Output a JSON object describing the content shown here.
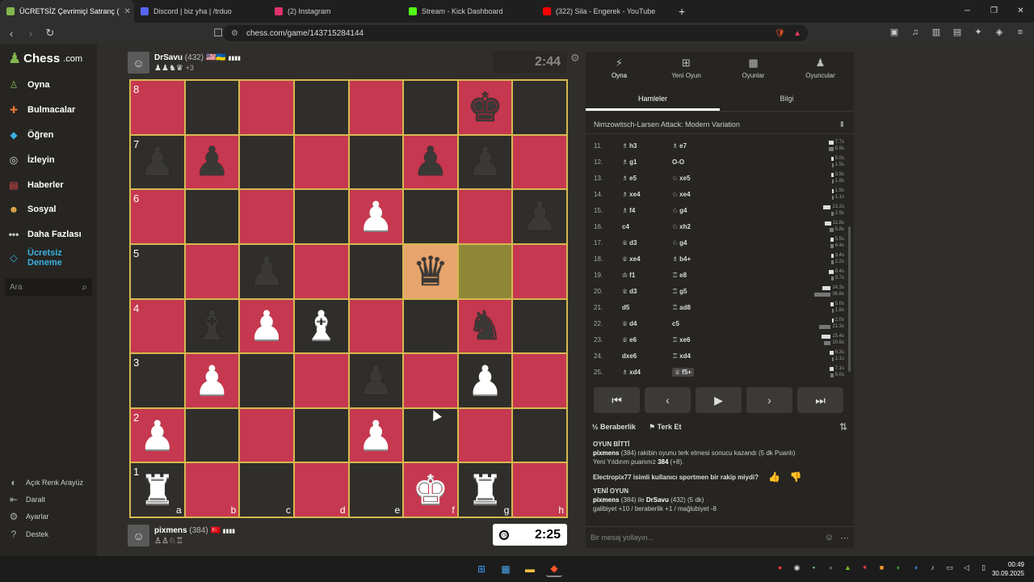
{
  "browser": {
    "tabs": [
      {
        "label": "ÜCRETSİZ Çevrimiçi Satranç (",
        "active": true,
        "color": "#81b64c"
      },
      {
        "label": "Discord | biz yha | /trduo",
        "active": false,
        "color": "#5865f2"
      },
      {
        "label": "(2) Instagram",
        "active": false,
        "color": "#e1306c"
      },
      {
        "label": "Stream - Kick Dashboard",
        "active": false,
        "color": "#53fc18"
      },
      {
        "label": "(322) Sila - Engerek - YouTube",
        "active": false,
        "color": "#ff0000"
      }
    ],
    "new_tab": "+",
    "url": "chess.com/game/143715284144"
  },
  "sidebar": {
    "logo": "Chess",
    "logo_suffix": ".com",
    "items": [
      {
        "label": "Oyna",
        "icon": "play-board-icon",
        "color": "#81b64c"
      },
      {
        "label": "Bulmacalar",
        "icon": "puzzle-icon",
        "color": "#e8772e"
      },
      {
        "label": "Öğren",
        "icon": "learn-icon",
        "color": "#3bb0e0"
      },
      {
        "label": "İzleyin",
        "icon": "binoculars-icon",
        "color": "#dddddd"
      },
      {
        "label": "Haberler",
        "icon": "news-icon",
        "color": "#e84a4a"
      },
      {
        "label": "Sosyal",
        "icon": "social-icon",
        "color": "#e8b04a"
      },
      {
        "label": "Daha Fazlası",
        "icon": "more-icon",
        "color": "#cccccc"
      },
      {
        "label": "Ücretsiz Deneme",
        "icon": "diamond-icon",
        "color": "#3bb0e0"
      }
    ],
    "search_placeholder": "Ara",
    "footer": [
      {
        "label": "Açık Renk Arayüz",
        "icon": "theme-toggle-icon"
      },
      {
        "label": "Daralt",
        "icon": "collapse-icon"
      },
      {
        "label": "Ayarlar",
        "icon": "settings-icon"
      },
      {
        "label": "Destek",
        "icon": "help-icon"
      }
    ]
  },
  "top_player": {
    "name": "DrSavu",
    "rating": "(432)",
    "flags": "🇺🇸🇺🇦",
    "signal": "▮▮▮▮",
    "captured": "♟♟♞♛",
    "extra": "+3"
  },
  "bottom_player": {
    "name": "pixmens",
    "rating": "(384)",
    "flags": "🇹🇷",
    "signal": "▮▮▮▮",
    "captured": "♙♙♘♖"
  },
  "clocks": {
    "top": "2:44",
    "bottom": "2:25"
  },
  "board": {
    "ranks": [
      "8",
      "7",
      "6",
      "5",
      "4",
      "3",
      "2",
      "1"
    ],
    "files": [
      "a",
      "b",
      "c",
      "d",
      "e",
      "f",
      "g",
      "h"
    ],
    "squares": [
      [
        "",
        "",
        "",
        "",
        "",
        "",
        "bk",
        ""
      ],
      [
        "bp",
        "bp",
        "",
        "",
        "",
        "bp",
        "bp",
        ""
      ],
      [
        "",
        "",
        "",
        "",
        "wp",
        "",
        "",
        "bp"
      ],
      [
        "",
        "",
        "bp",
        "",
        "",
        "bq",
        "",
        ""
      ],
      [
        "",
        "bb",
        "wp",
        "wb",
        "",
        "",
        "bn",
        ""
      ],
      [
        "",
        "wp",
        "",
        "",
        "bp",
        "",
        "wp",
        ""
      ],
      [
        "wp",
        "",
        "",
        "",
        "wp",
        "",
        "",
        ""
      ],
      [
        "wr",
        "",
        "",
        "",
        "",
        "wk",
        "wr",
        ""
      ]
    ],
    "highlight_from": "g5",
    "highlight_to": "f5"
  },
  "panel": {
    "tabs": [
      {
        "label": "Oyna",
        "icon": "bolt-icon"
      },
      {
        "label": "Yeni Oyun",
        "icon": "plus-icon"
      },
      {
        "label": "Oyunlar",
        "icon": "board-icon"
      },
      {
        "label": "Oyuncular",
        "icon": "players-icon"
      }
    ],
    "subtabs": [
      "Hamleler",
      "Bilgi"
    ],
    "opening": "Nimzowitsch-Larsen Attack: Modern Variation",
    "moves": [
      {
        "n": "11.",
        "w": "h3",
        "wp": "♗",
        "b": "e7",
        "bp": "♗",
        "wt": "7.7s",
        "bt": "8.9s",
        "ww": 6,
        "bw": 6
      },
      {
        "n": "12.",
        "w": "g1",
        "wp": "♗",
        "b": "O-O",
        "bp": "",
        "wt": "5.0s",
        "bt": "1.5s",
        "ww": 3,
        "bw": 2
      },
      {
        "n": "13.",
        "w": "e5",
        "wp": "♗",
        "b": "xe5",
        "bp": "♘",
        "wt": "3.9s",
        "bt": "1.8s",
        "ww": 3,
        "bw": 2
      },
      {
        "n": "14.",
        "w": "xe4",
        "wp": "♗",
        "b": "xe4",
        "bp": "♘",
        "wt": "1.9s",
        "bt": "1.1s",
        "ww": 2,
        "bw": 2
      },
      {
        "n": "15.",
        "w": "f4",
        "wp": "♗",
        "b": "g4",
        "bp": "♘",
        "wt": "13.2s",
        "bt": "2.9s",
        "ww": 9,
        "bw": 3
      },
      {
        "n": "16.",
        "w": "c4",
        "wp": "",
        "b": "xh2",
        "bp": "♘",
        "wt": "11.8s",
        "bt": "5.8s",
        "ww": 8,
        "bw": 5
      },
      {
        "n": "17.",
        "w": "d3",
        "wp": "♕",
        "b": "g4",
        "bp": "♘",
        "wt": "5.5s",
        "bt": "4.4s",
        "ww": 4,
        "bw": 4
      },
      {
        "n": "18.",
        "w": "xe4",
        "wp": "♕",
        "b": "b4+",
        "bp": "♗",
        "wt": "3.4s",
        "bt": "2.2s",
        "ww": 3,
        "bw": 3
      },
      {
        "n": "19.",
        "w": "f1",
        "wp": "♔",
        "b": "e8",
        "bp": "♖",
        "wt": "8.4s",
        "bt": "3.7s",
        "ww": 6,
        "bw": 3
      },
      {
        "n": "20.",
        "w": "d3",
        "wp": "♕",
        "b": "g5",
        "bp": "♖",
        "wt": "14.3s",
        "bt": "36.8s",
        "ww": 10,
        "bw": 20
      },
      {
        "n": "21.",
        "w": "d5",
        "wp": "",
        "b": "ad8",
        "bp": "♖",
        "wt": "5.0s",
        "bt": "1.8s",
        "ww": 4,
        "bw": 2
      },
      {
        "n": "22.",
        "w": "d4",
        "wp": "♕",
        "b": "c5",
        "bp": "",
        "wt": "2.0s",
        "bt": "21.3s",
        "ww": 2,
        "bw": 14
      },
      {
        "n": "23.",
        "w": "e6",
        "wp": "♕",
        "b": "xe6",
        "bp": "♖",
        "wt": "15.4s",
        "bt": "10.9s",
        "ww": 11,
        "bw": 8
      },
      {
        "n": "24.",
        "w": "dxe6",
        "wp": "",
        "b": "xd4",
        "bp": "♖",
        "wt": "6.3s",
        "bt": "1.1s",
        "ww": 5,
        "bw": 2
      },
      {
        "n": "25.",
        "w": "xd4",
        "wp": "♗",
        "b": "f5+",
        "bp": "♕",
        "wt": "7.1s",
        "bt": "5.0s",
        "ww": 5,
        "bw": 4
      }
    ],
    "controls": [
      "⏮",
      "‹",
      "▶",
      "›",
      "⏭"
    ],
    "draw_label": "Beraberlik",
    "resign_label": "Terk Et",
    "chat": {
      "game_over": "OYUN BİTTİ",
      "result_name": "pixmens",
      "result_text": "(384) rakibin oyunu terk etmesi sonucu kazandı (5 dk Puanlı)",
      "rating_text": "Yeni Yıldırım puanınız",
      "rating_value": "384",
      "rating_change": "(+8).",
      "sportsman": "Electropix77 isimli kullanıcı sportmen bir rakip miydi?",
      "new_game": "YENİ OYUN",
      "new_game_p1": "pixmens",
      "new_game_mid": "(384) ile",
      "new_game_p2": "DrSavu",
      "new_game_tail": "(432) (5 dk)",
      "stats": "galibiyet +10 / beraberlik +1 / mağlubiyet -8",
      "placeholder": "Bir mesaj yollayın..."
    }
  },
  "taskbar": {
    "time": "00:49",
    "date": "30.09.2025"
  }
}
